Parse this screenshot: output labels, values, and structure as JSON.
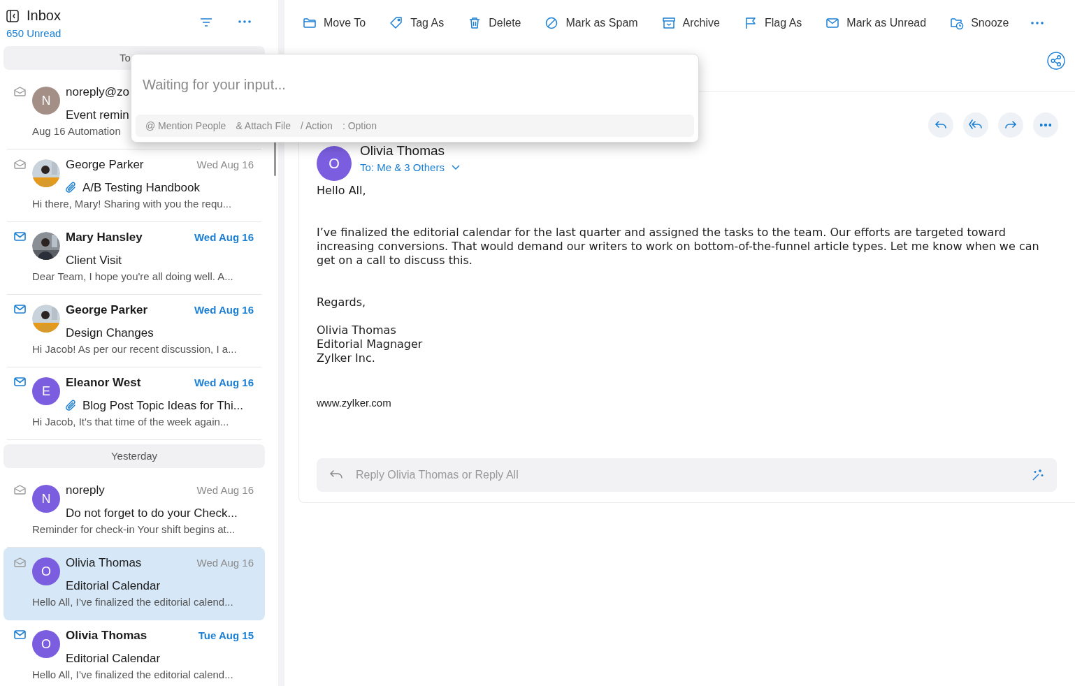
{
  "folder": {
    "title": "Inbox",
    "unread_count": "650 Unread"
  },
  "list": [
    {
      "kind": "separator",
      "label": "To"
    },
    {
      "kind": "mail",
      "sender": "noreply@zo",
      "subject": "Event remin",
      "preview": "Aug 16 Automation",
      "unread": false,
      "selected": false,
      "attachment": false,
      "avatar": {
        "kind": "letter",
        "letter": "N",
        "color": "#a38f86"
      }
    },
    {
      "kind": "mail",
      "sender": "George Parker",
      "date": "Wed Aug 16",
      "subject": "A/B Testing Handbook",
      "preview": "Hi there, Mary! Sharing with you the requ...",
      "unread": false,
      "selected": false,
      "attachment": true
    },
    {
      "kind": "mail",
      "sender": "Mary Hansley",
      "date": "Wed Aug 16",
      "subject": "Client Visit",
      "preview": "Dear Team, I hope you're all doing well. A...",
      "unread": true,
      "selected": false,
      "attachment": false
    },
    {
      "kind": "mail",
      "sender": "George Parker",
      "date": "Wed Aug 16",
      "subject": "Design Changes",
      "preview": "Hi Jacob! As per our recent discussion, I a...",
      "unread": true,
      "selected": false,
      "attachment": false
    },
    {
      "kind": "mail",
      "sender": "Eleanor West",
      "date": "Wed Aug 16",
      "subject": "Blog Post Topic Ideas for Thi...",
      "preview": "Hi Jacob, It's that time of the week again...",
      "unread": true,
      "selected": false,
      "attachment": true,
      "avatar": {
        "kind": "letter",
        "letter": "E",
        "color": "#7b5ee0"
      }
    },
    {
      "kind": "separator",
      "label": "Yesterday"
    },
    {
      "kind": "mail",
      "sender": "noreply",
      "date": "Wed Aug 16",
      "subject": "Do not forget to do your Check...",
      "preview": "Reminder for check-in Your shift begins at...",
      "unread": false,
      "selected": false,
      "attachment": false,
      "avatar": {
        "kind": "letter",
        "letter": "N",
        "color": "#7b5ee0"
      }
    },
    {
      "kind": "mail",
      "sender": "Olivia Thomas",
      "date": "Wed Aug 16",
      "subject": "Editorial Calendar",
      "preview": "Hello All, I’ve finalized the editorial calend...",
      "unread": false,
      "selected": true,
      "attachment": false,
      "avatar": {
        "kind": "letter",
        "letter": "O",
        "color": "#7b5ee0"
      }
    },
    {
      "kind": "mail",
      "sender": "Olivia Thomas",
      "date": "Tue Aug 15",
      "subject": "Editorial Calendar",
      "preview": "Hello All, I’ve finalized the editorial calend...",
      "unread": true,
      "selected": false,
      "attachment": false,
      "avatar": {
        "kind": "letter",
        "letter": "O",
        "color": "#7b5ee0"
      }
    }
  ],
  "toolbar": [
    "Move To",
    "Tag As",
    "Delete",
    "Mark as Spam",
    "Archive",
    "Flag As",
    "Mark as Unread",
    "Snooze"
  ],
  "message": {
    "sender": "Olivia Thomas",
    "avatar_letter": "O",
    "recipients": "To: Me & 3 Others",
    "body": [
      "Hello All,",
      "I’ve finalized the editorial calendar for the last quarter and assigned the tasks to the team. Our efforts are targeted toward increasing conversions. That would demand our writers to work on bottom-of-the-funnel article types. Let me know when we can get on a call to discuss this.",
      "Regards,"
    ],
    "signature": [
      "Olivia Thomas",
      "Editorial Magnager",
      "Zylker Inc."
    ],
    "website": "www.zylker.com",
    "reply_placeholder": "Reply Olivia Thomas or Reply All"
  },
  "prompt": {
    "placeholder": "Waiting for your input...",
    "hints": [
      "@ Mention People",
      "& Attach File",
      "/ Action",
      ": Option"
    ]
  }
}
